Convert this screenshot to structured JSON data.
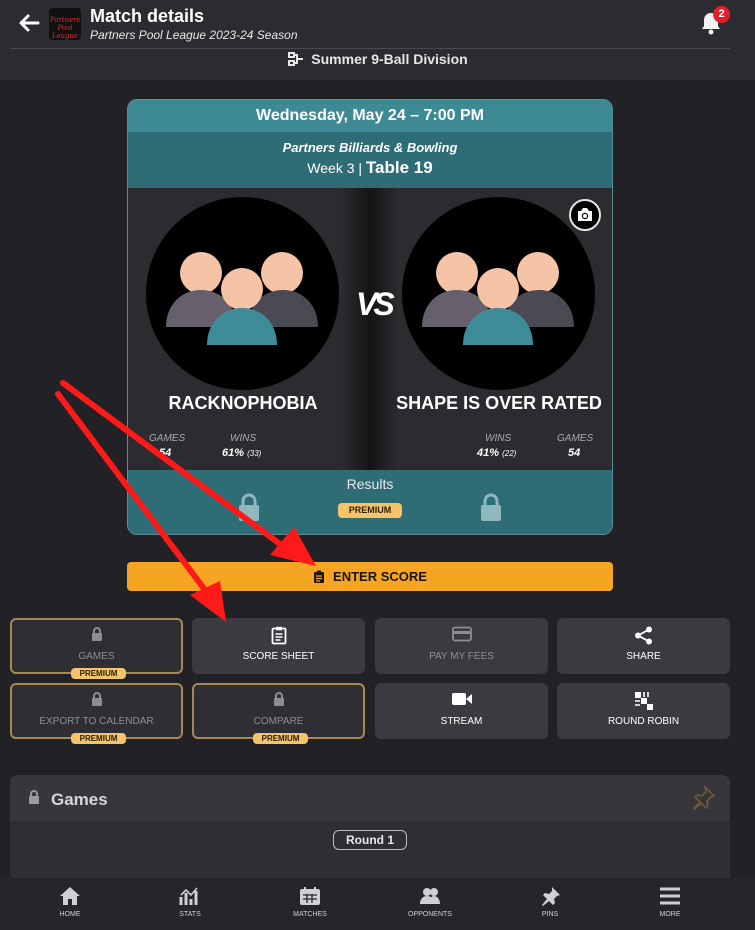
{
  "header": {
    "title": "Match details",
    "subtitle": "Partners Pool League 2023-24 Season",
    "logo_text": "Partners Pool League",
    "notification_count": "2"
  },
  "division": {
    "label": "Summer 9-Ball Division"
  },
  "match": {
    "datetime": "Wednesday, May 24 – 7:00 PM",
    "venue": "Partners Billiards & Bowling",
    "week": "Week 3",
    "separator": "|",
    "table": "Table 19",
    "vs": "VS",
    "home": {
      "name": "RACKNOPHOBIA",
      "games_label": "GAMES",
      "games_value": "54",
      "wins_label": "WINS",
      "wins_pct": "61%",
      "wins_count": "(33)"
    },
    "away": {
      "name": "SHAPE IS OVER RATED",
      "games_label": "GAMES",
      "games_value": "54",
      "wins_label": "WINS",
      "wins_pct": "41%",
      "wins_count": "(22)"
    },
    "results_label": "Results",
    "premium_label": "PREMIUM"
  },
  "enter_score": {
    "label": "ENTER SCORE"
  },
  "actions": {
    "games": {
      "label": "GAMES",
      "premium": "PREMIUM"
    },
    "score_sheet": {
      "label": "SCORE SHEET"
    },
    "pay_fees": {
      "label": "PAY MY FEES"
    },
    "share": {
      "label": "SHARE"
    },
    "export_calendar": {
      "label": "EXPORT TO CALENDAR",
      "premium": "PREMIUM"
    },
    "compare": {
      "label": "COMPARE",
      "premium": "PREMIUM"
    },
    "stream": {
      "label": "STREAM"
    },
    "round_robin": {
      "label": "ROUND ROBIN"
    }
  },
  "games_panel": {
    "title": "Games",
    "round_label": "Round 1"
  },
  "bottom_nav": {
    "home": "HOME",
    "stats": "STATS",
    "matches": "MATCHES",
    "opponents": "OPPONENTS",
    "pins": "PINS",
    "more": "MORE"
  },
  "colors": {
    "accent_orange": "#f6a523",
    "teal_band": "#2f6d76",
    "teal_date": "#3d8a95",
    "premium_gold": "#f5c46a",
    "annotation_arrow": "#ff1a1a"
  }
}
